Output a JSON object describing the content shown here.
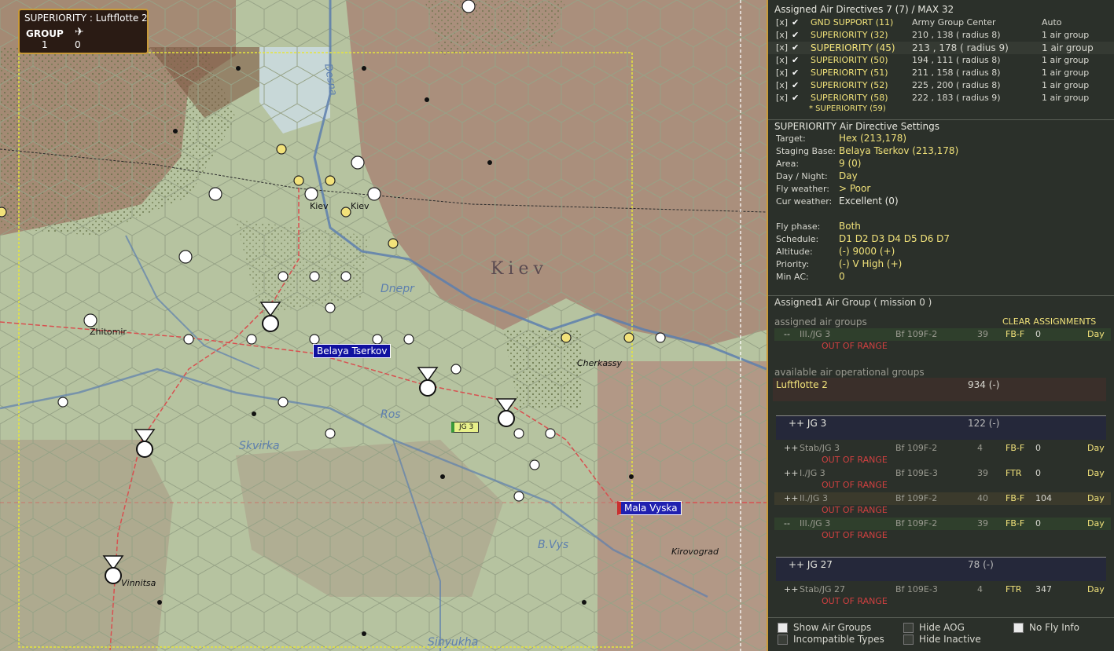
{
  "overlay": {
    "title": "SUPERIORITY : Luftflotte 2",
    "group_label": "GROUP",
    "group_count": "1",
    "plane_count": "0"
  },
  "map_labels": {
    "belaya": "Belaya Tserkov",
    "mala": "Mala Vyska",
    "jg3_counter": "JG 3",
    "kiev_region": "Kiev",
    "kiev1": "Kiev",
    "kiev2": "Kiev",
    "dnepr": "Dnepr",
    "zhitomir": "Zhitomir",
    "cherkassy": "Cherkassy",
    "skvirka": "Skvirka",
    "ros": "Ros",
    "vinnitsa": "Vinnitsa",
    "kirovograd": "Kirovograd",
    "bvys": "B.Vys",
    "sinyukha": "Sinyukha",
    "desna": "Desna"
  },
  "directives": {
    "header": "Assigned Air Directives 7 (7) / MAX 32",
    "rows": [
      {
        "x": "[x]",
        "name": "GND SUPPORT (11)",
        "target": "Army Group Center",
        "amount": "Auto"
      },
      {
        "x": "[x]",
        "name": "SUPERIORITY (32)",
        "target": "210 , 138 ( radius 8)",
        "amount": "1 air group"
      },
      {
        "x": "[x]",
        "name": "SUPERIORITY (45)",
        "target": "213 , 178 ( radius 9)",
        "amount": "1 air group"
      },
      {
        "x": "[x]",
        "name": "SUPERIORITY (50)",
        "target": "194 , 111 ( radius 8)",
        "amount": "1 air group"
      },
      {
        "x": "[x]",
        "name": "SUPERIORITY (51)",
        "target": "211 , 158 ( radius 8)",
        "amount": "1 air group"
      },
      {
        "x": "[x]",
        "name": "SUPERIORITY (52)",
        "target": "225 , 200 ( radius 8)",
        "amount": "1 air group"
      },
      {
        "x": "[x]",
        "name": "SUPERIORITY (58)",
        "target": "222 , 183 ( radius 9)",
        "amount": "1 air group"
      }
    ],
    "partial": "* SUPERIORITY (59)"
  },
  "settings": {
    "header": "SUPERIORITY Air Directive Settings",
    "rows": [
      {
        "k": "Target:",
        "v": "Hex (213,178)"
      },
      {
        "k": "Staging Base:",
        "v": "Belaya Tserkov (213,178)"
      },
      {
        "k": "Area:",
        "v": "9 (0)"
      },
      {
        "k": "Day / Night:",
        "v": "Day"
      },
      {
        "k": "Fly weather:",
        "v": "> Poor"
      },
      {
        "k": "Cur weather:",
        "v": "Excellent (0)"
      },
      {
        "k": "Fly phase:",
        "v": "Both"
      },
      {
        "k": "Schedule:",
        "v": "D1 D2 D3 D4 D5 D6 D7"
      },
      {
        "k": "Altitude:",
        "v": "(-) 9000 (+)"
      },
      {
        "k": "Priority:",
        "v": "(-) V High (+)"
      },
      {
        "k": "Min AC:",
        "v": "0"
      }
    ]
  },
  "assigned": {
    "label": "Assigned",
    "value": "1 Air Group  ( mission 0 )",
    "groups_label": "assigned air groups",
    "clear": "CLEAR ASSIGNMENTS",
    "row": {
      "mark": "--",
      "unit": "III./JG 3",
      "ac": "Bf 109F-2",
      "n": "39",
      "type": "FB-F",
      "m": "0",
      "time": "Day",
      "status": "OUT OF RANGE"
    }
  },
  "available": {
    "label": "available air operational groups",
    "fleet": "Luftflotte 2",
    "fleet_val": "934 (-)",
    "groups": [
      {
        "name": "++ JG 3",
        "val": "122 (-)",
        "units": [
          {
            "mark": "++",
            "unit": "Stab/JG 3",
            "ac": "Bf 109F-2",
            "n": "4",
            "type": "FB-F",
            "m": "0",
            "time": "Day",
            "status": "OUT OF RANGE"
          },
          {
            "mark": "++",
            "unit": "I./JG 3",
            "ac": "Bf 109E-3",
            "n": "39",
            "type": "FTR",
            "m": "0",
            "time": "Day",
            "status": "OUT OF RANGE"
          },
          {
            "mark": "++",
            "unit": "II./JG 3",
            "ac": "Bf 109F-2",
            "n": "40",
            "type": "FB-F",
            "m": "104",
            "time": "Day",
            "status": "OUT OF RANGE"
          },
          {
            "mark": "--",
            "unit": "III./JG 3",
            "ac": "Bf 109F-2",
            "n": "39",
            "type": "FB-F",
            "m": "0",
            "time": "Day",
            "status": "OUT OF RANGE"
          }
        ]
      },
      {
        "name": "++ JG 27",
        "val": "78 (-)",
        "units": [
          {
            "mark": "++",
            "unit": "Stab/JG 27",
            "ac": "Bf 109E-3",
            "n": "4",
            "type": "FTR",
            "m": "347",
            "time": "Day",
            "status": "OUT OF RANGE"
          }
        ]
      }
    ]
  },
  "footer": {
    "show_air_groups": "Show Air Groups",
    "incompatible": "Incompatible Types",
    "hide_aog": "Hide AOG",
    "hide_inactive": "Hide Inactive",
    "no_fly": "No Fly Info"
  },
  "colors": {
    "accent": "#c89a3a",
    "yellow_text": "#f1e27a",
    "red_text": "#d04040",
    "panel_bg": "#2b302a"
  }
}
